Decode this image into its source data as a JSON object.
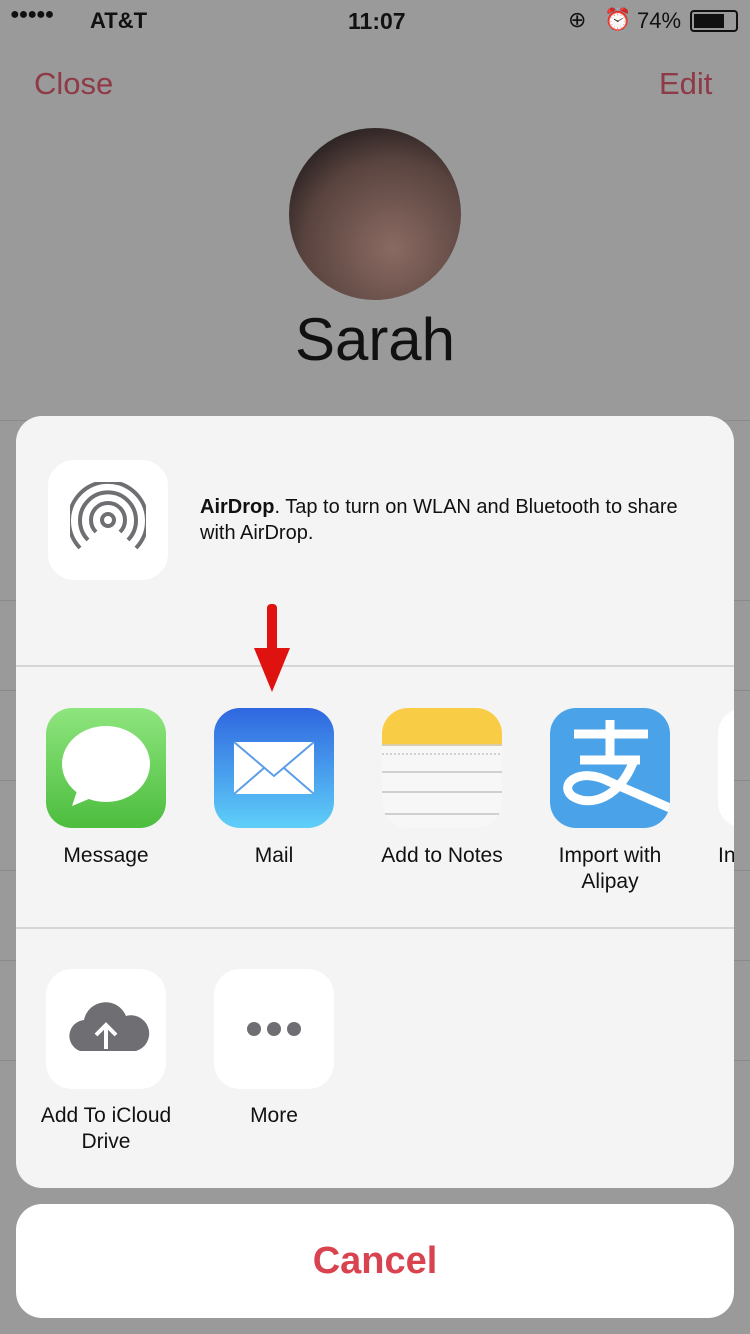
{
  "status_bar": {
    "carrier": "AT&T",
    "time": "11:07",
    "battery": "74%",
    "battery_level": 0.74
  },
  "nav": {
    "close": "Close",
    "edit": "Edit"
  },
  "contact": {
    "name": "Sarah"
  },
  "airdrop": {
    "title": "AirDrop",
    "text": ". Tap to turn on WLAN and Bluetooth to share with AirDrop."
  },
  "apps": [
    {
      "label": "Message",
      "icon": "message-icon"
    },
    {
      "label": "Mail",
      "icon": "mail-icon"
    },
    {
      "label": "Add to Notes",
      "icon": "notes-icon"
    },
    {
      "label": "Import with Alipay",
      "icon": "alipay-icon"
    },
    {
      "label": "In",
      "icon": "partial-app-icon"
    }
  ],
  "actions": [
    {
      "label": "Add To iCloud Drive",
      "icon": "icloud-upload-icon"
    },
    {
      "label": "More",
      "icon": "more-icon"
    }
  ],
  "cancel": "Cancel",
  "colors": {
    "accent": "#d9434f",
    "arrow": "#e0120f"
  }
}
